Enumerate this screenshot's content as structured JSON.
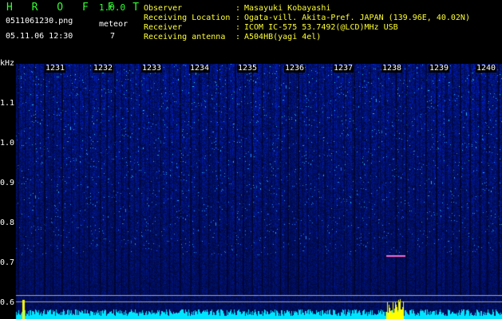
{
  "app": {
    "name": "H R O F F T",
    "version": "1.0.0"
  },
  "file": {
    "name": "0511061230.png",
    "datetime": "05.11.06 12:30"
  },
  "meteor": {
    "label": "meteor",
    "count": "7"
  },
  "info": {
    "labels": [
      "Observer",
      "Receiving Location",
      "Receiver",
      "Receiving antenna"
    ],
    "colons": [
      ":",
      ":",
      ":",
      ":"
    ],
    "values": [
      "Masayuki Kobayashi",
      "Ogata-vill. Akita-Pref. JAPAN (139.96E, 40.02N)",
      "ICOM IC-575 53.7492(@LCD)MHz USB",
      "A504HB(yagi 4el)"
    ]
  },
  "axis": {
    "unit": "kHz",
    "y_ticks": [
      "1.1",
      "1.0",
      "0.9",
      "0.8",
      "0.7",
      "0.6"
    ],
    "x_ticks": [
      "1231",
      "1232",
      "1233",
      "1234",
      "1235",
      "1236",
      "1237",
      "1238",
      "1239",
      "1240"
    ]
  },
  "colors": {
    "bg_low": "#00104a",
    "bg_high": "#2c5cff",
    "noise": "#66ddff",
    "trace": "#ffff00",
    "guide": "#aaaaaa"
  }
}
